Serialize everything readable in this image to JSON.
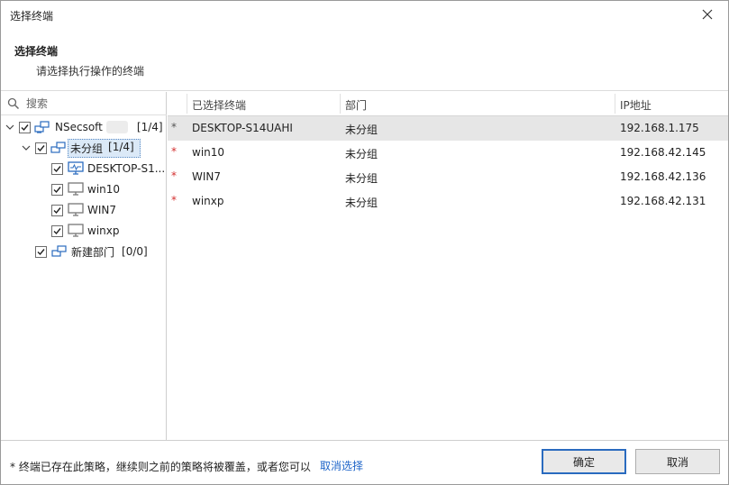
{
  "window": {
    "title": "选择终端"
  },
  "header": {
    "title": "选择终端",
    "subtitle": "请选择执行操作的终端"
  },
  "search": {
    "placeholder": "搜索"
  },
  "tree": {
    "root": {
      "label": "NSecsoft",
      "count": "[1/4]"
    },
    "group": {
      "label": "未分组",
      "count": "[1/4]"
    },
    "items": [
      {
        "label": "DESKTOP-S1...",
        "icon": "monitor-active-icon"
      },
      {
        "label": "win10",
        "icon": "monitor-icon"
      },
      {
        "label": "WIN7",
        "icon": "monitor-icon"
      },
      {
        "label": "winxp",
        "icon": "monitor-icon"
      }
    ],
    "dept": {
      "label": "新建部门",
      "count": "[0/0]"
    }
  },
  "table": {
    "columns": [
      "已选择终端",
      "部门",
      "IP地址"
    ],
    "rows": [
      {
        "star": "*",
        "name": "DESKTOP-S14UAHI",
        "dept": "未分组",
        "ip": "192.168.1.175"
      },
      {
        "star": "*",
        "name": "win10",
        "dept": "未分组",
        "ip": "192.168.42.145"
      },
      {
        "star": "*",
        "name": "WIN7",
        "dept": "未分组",
        "ip": "192.168.42.136"
      },
      {
        "star": "*",
        "name": "winxp",
        "dept": "未分组",
        "ip": "192.168.42.131"
      }
    ]
  },
  "footer": {
    "note": "* 终端已存在此策略，继续则之前的策略将被覆盖，或者您可以",
    "link": "取消选择",
    "ok": "确定",
    "cancel": "取消"
  },
  "colors": {
    "accent": "#1e64c8",
    "selection": "#dbe9f7",
    "star_red": "#d32f2f"
  }
}
